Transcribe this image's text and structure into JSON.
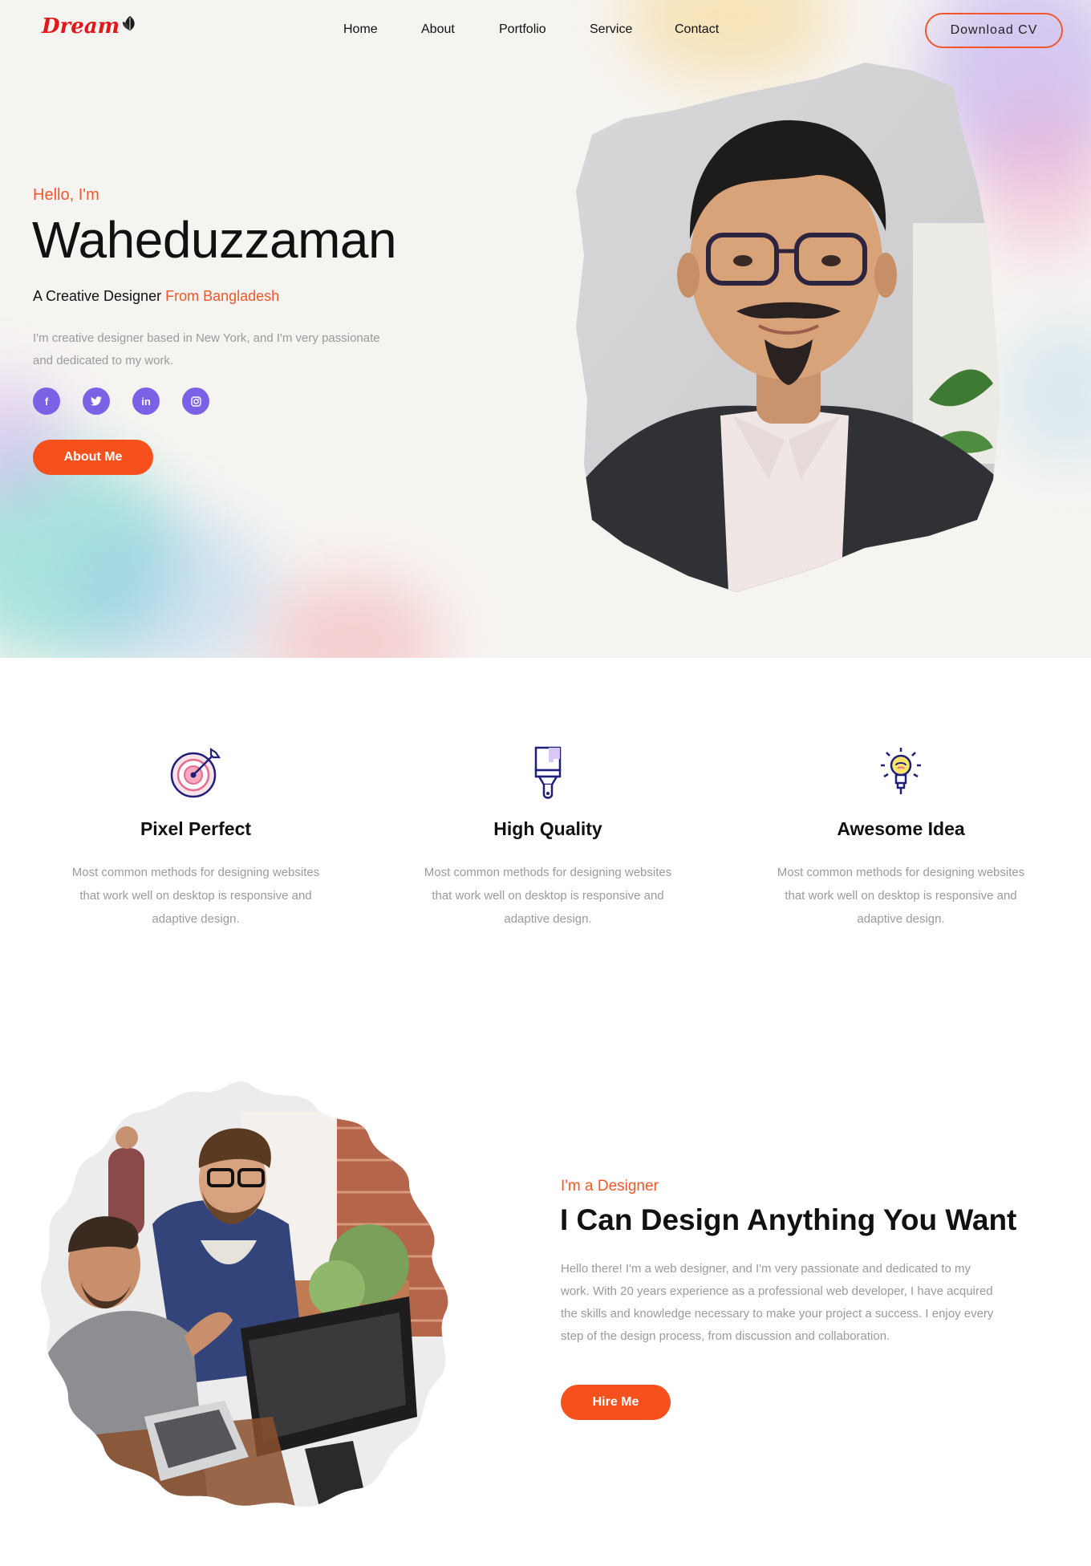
{
  "brand": {
    "logo_text": "Dream"
  },
  "nav": {
    "items": [
      {
        "label": "Home"
      },
      {
        "label": "About"
      },
      {
        "label": "Portfolio"
      },
      {
        "label": "Service"
      },
      {
        "label": "Contact"
      }
    ],
    "cta_label": "Download CV"
  },
  "hero": {
    "greeting": "Hello, I'm",
    "name": "Waheduzzaman",
    "tagline_prefix": "A Creative Designer ",
    "tagline_highlight": "From Bangladesh",
    "intro": "I'm creative designer based in New York, and I'm very passionate and dedicated to my work.",
    "social_icons": [
      "facebook-icon",
      "twitter-icon",
      "linkedin-icon",
      "instagram-icon"
    ],
    "social_glyphs": [
      "f",
      "t",
      "in",
      "ig"
    ],
    "button_label": "About Me"
  },
  "features": [
    {
      "icon": "target-icon",
      "title": "Pixel Perfect",
      "desc": "Most common methods for designing websites that work well on desktop is responsive and adaptive design."
    },
    {
      "icon": "paint-brush-icon",
      "title": "High Quality",
      "desc": "Most common methods for designing websites that work well on desktop is responsive and adaptive design."
    },
    {
      "icon": "lightbulb-icon",
      "title": "Awesome Idea",
      "desc": "Most common methods for designing websites that work well on desktop is responsive and adaptive design."
    }
  ],
  "about": {
    "eyebrow": "I'm a Designer",
    "title": "I Can Design Anything You Want",
    "text": "Hello there! I'm a web designer, and I'm very passionate and dedicated to my work. With 20 years experience as a professional web developer, I have acquired the skills and knowledge necessary to make your project a success. I enjoy every step of the design process, from discussion and collaboration.",
    "button_label": "Hire Me"
  },
  "colors": {
    "accent": "#f6511d",
    "social": "#7b61e6",
    "icon_navy": "#1f1f7a",
    "muted_text": "#9a9a9a"
  }
}
